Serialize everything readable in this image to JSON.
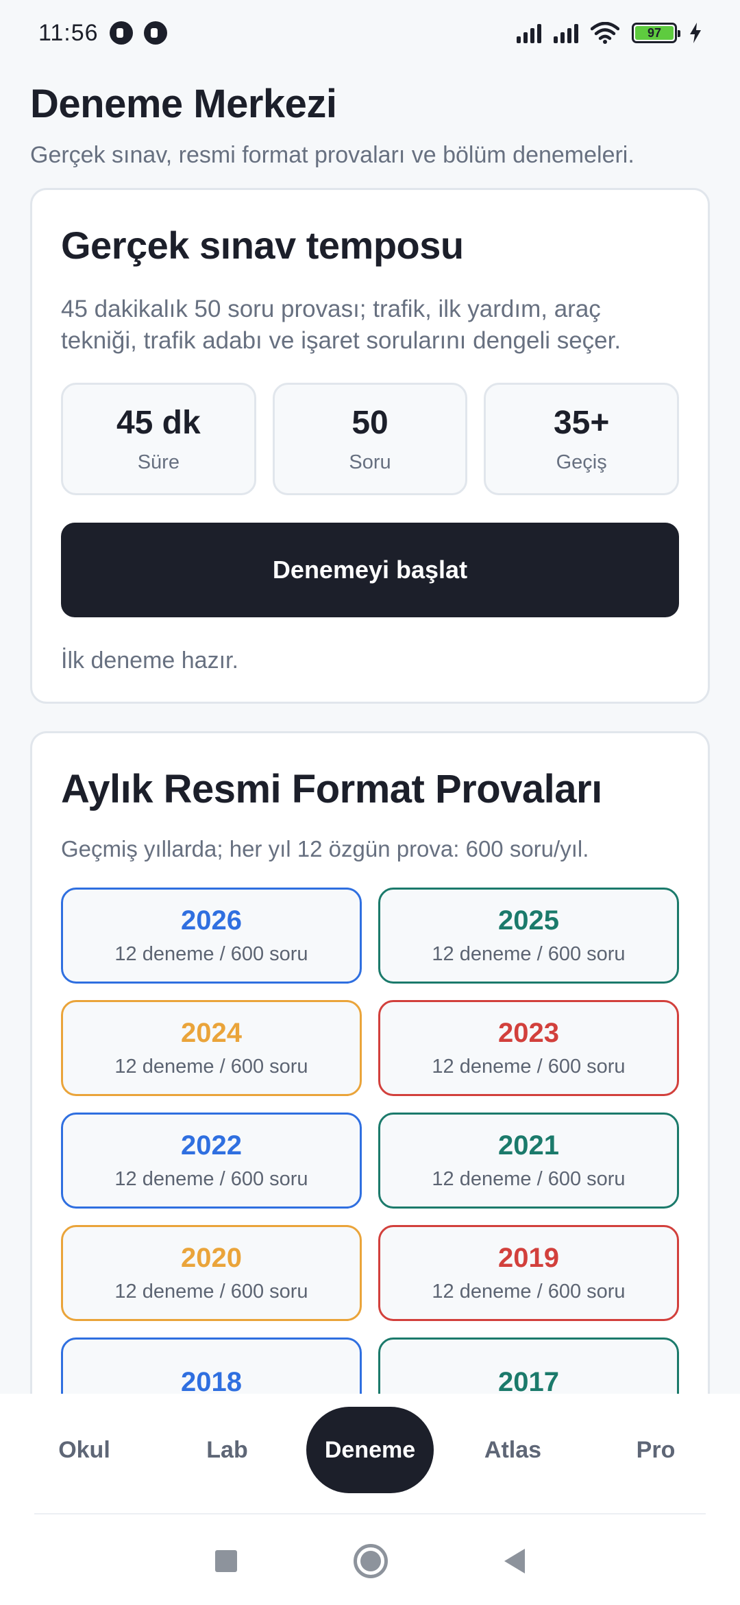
{
  "status_bar": {
    "time": "11:56",
    "battery_level": "97",
    "battery_color": "#5ecb3f"
  },
  "page": {
    "title": "Deneme Merkezi",
    "subtitle": "Gerçek sınav, resmi format provaları ve bölüm denemeleri."
  },
  "exam_card": {
    "title": "Gerçek sınav temposu",
    "description": "45 dakikalık 50 soru provası; trafik, ilk yardım, araç tekniği, trafik adabı ve işaret sorularını dengeli seçer.",
    "stats": [
      {
        "value": "45 dk",
        "label": "Süre"
      },
      {
        "value": "50",
        "label": "Soru"
      },
      {
        "value": "35+",
        "label": "Geçiş"
      }
    ],
    "start_button": "Denemeyi başlat",
    "status_note": "İlk deneme hazır."
  },
  "monthly_card": {
    "title": "Aylık Resmi Format Provaları",
    "description": "Geçmiş yıllarda; her yıl 12 özgün prova: 600 soru/yıl.",
    "years": [
      {
        "year": "2026",
        "meta": "12 deneme / 600 soru",
        "color": "#2f6fe0"
      },
      {
        "year": "2025",
        "meta": "12 deneme / 600 soru",
        "color": "#1b7a6b"
      },
      {
        "year": "2024",
        "meta": "12 deneme / 600 soru",
        "color": "#eaa43a"
      },
      {
        "year": "2023",
        "meta": "12 deneme / 600 soru",
        "color": "#d2403c"
      },
      {
        "year": "2022",
        "meta": "12 deneme / 600 soru",
        "color": "#2f6fe0"
      },
      {
        "year": "2021",
        "meta": "12 deneme / 600 soru",
        "color": "#1b7a6b"
      },
      {
        "year": "2020",
        "meta": "12 deneme / 600 soru",
        "color": "#eaa43a"
      },
      {
        "year": "2019",
        "meta": "12 deneme / 600 soru",
        "color": "#d2403c"
      },
      {
        "year": "2018",
        "meta": "",
        "color": "#2f6fe0"
      },
      {
        "year": "2017",
        "meta": "",
        "color": "#1b7a6b"
      }
    ]
  },
  "bottom_nav": {
    "active": "Deneme",
    "tabs": [
      "Okul",
      "Lab",
      "Deneme",
      "Atlas",
      "Pro"
    ]
  },
  "colors": {
    "primary_dark": "#1c1f2a",
    "muted_text": "#677080",
    "card_border": "#e1e6ec"
  }
}
